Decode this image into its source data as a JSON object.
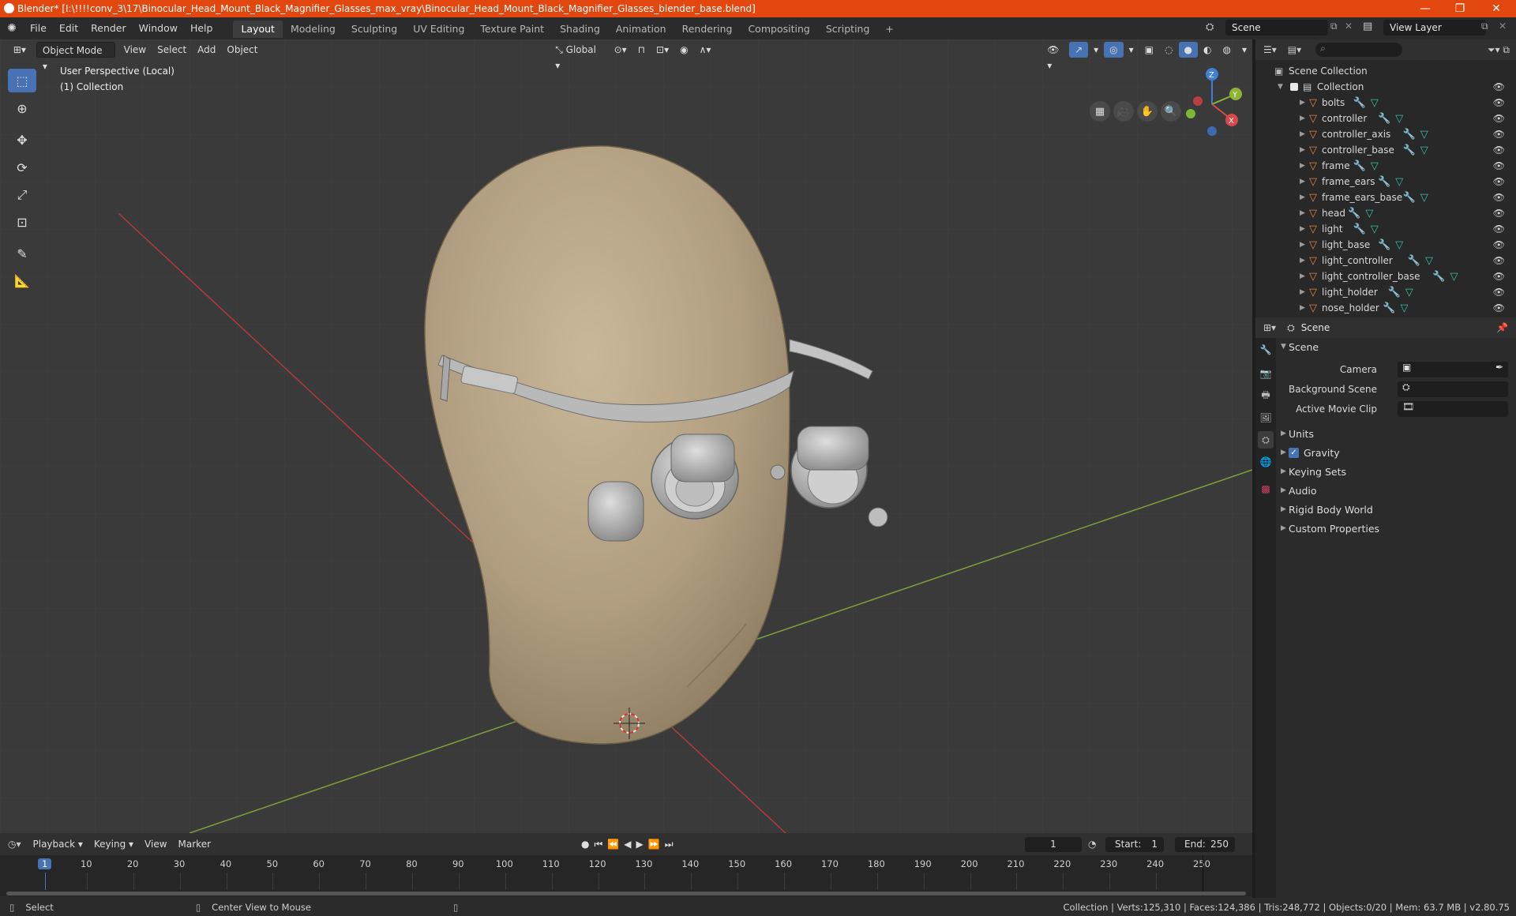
{
  "titlebar": {
    "title": "Blender* [I:\\!!!!conv_3\\17\\Binocular_Head_Mount_Black_Magnifier_Glasses_max_vray\\Binocular_Head_Mount_Black_Magnifier_Glasses_blender_base.blend]",
    "minimize": "—",
    "restore": "❐",
    "close": "✕"
  },
  "menu": [
    "File",
    "Edit",
    "Render",
    "Window",
    "Help"
  ],
  "workspaces": [
    {
      "label": "Layout",
      "active": true
    },
    {
      "label": "Modeling"
    },
    {
      "label": "Sculpting"
    },
    {
      "label": "UV Editing"
    },
    {
      "label": "Texture Paint"
    },
    {
      "label": "Shading"
    },
    {
      "label": "Animation"
    },
    {
      "label": "Rendering"
    },
    {
      "label": "Compositing"
    },
    {
      "label": "Scripting"
    }
  ],
  "add_workspace": "+",
  "scene_name": "Scene",
  "view_layer": "View Layer",
  "viewport": {
    "mode": "Object Mode",
    "menus": [
      "View",
      "Select",
      "Add",
      "Object"
    ],
    "transform_orientation": "Global",
    "info_line1": "User Perspective (Local)",
    "info_line2": "(1) Collection",
    "gizmo": {
      "z": "Z",
      "y": "Y",
      "x": "X"
    }
  },
  "outliner": {
    "root": "Scene Collection",
    "collection": "Collection",
    "objects": [
      "bolts",
      "controller",
      "controller_axis",
      "controller_base",
      "frame",
      "frame_ears",
      "frame_ears_base",
      "head",
      "light",
      "light_base",
      "light_controller",
      "light_controller_base",
      "light_holder",
      "nose_holder"
    ]
  },
  "properties": {
    "context": "Scene",
    "section": "Scene",
    "fields": {
      "camera": "Camera",
      "background_scene": "Background Scene",
      "active_movie_clip": "Active Movie Clip"
    },
    "panels": [
      "Units",
      "Gravity",
      "Keying Sets",
      "Audio",
      "Rigid Body World",
      "Custom Properties"
    ]
  },
  "timeline": {
    "menus": [
      "Playback",
      "Keying",
      "View",
      "Marker"
    ],
    "current_frame": "1",
    "start_label": "Start:",
    "start": "1",
    "end_label": "End:",
    "end": "250",
    "ticks": [
      "1",
      "10",
      "20",
      "30",
      "40",
      "50",
      "60",
      "70",
      "80",
      "90",
      "100",
      "110",
      "120",
      "130",
      "140",
      "150",
      "160",
      "170",
      "180",
      "190",
      "200",
      "210",
      "220",
      "230",
      "240",
      "250"
    ]
  },
  "statusbar": {
    "left": "Select",
    "middle": "Center View to Mouse",
    "right": "Collection | Verts:125,310 | Faces:124,386 | Tris:248,772 | Objects:0/20 | Mem: 63.7 MB | v2.80.75"
  },
  "colors": {
    "title_bar": "#e2470f",
    "accent_blue": "#4772b3",
    "object_orange": "#e8873b",
    "mesh_green": "#36c2a2",
    "head_skin": "#b8a689"
  }
}
